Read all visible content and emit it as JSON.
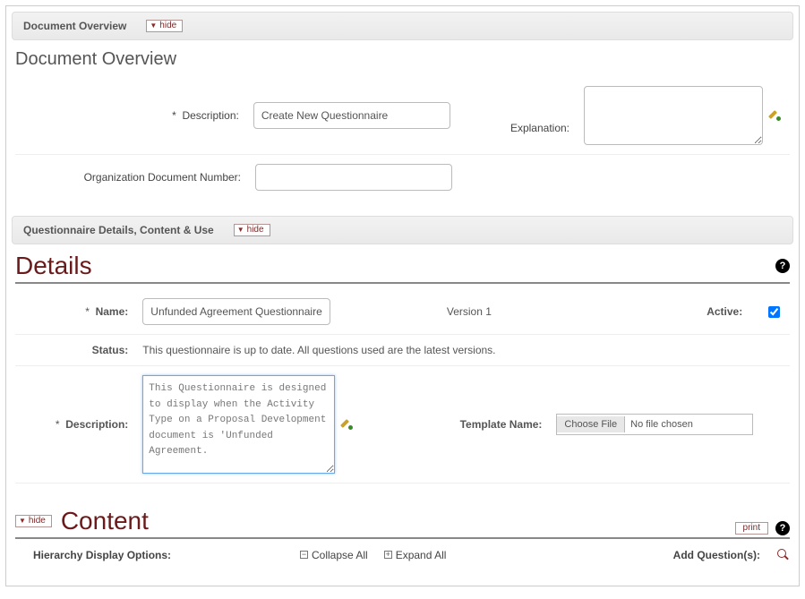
{
  "buttons": {
    "hide": "hide",
    "print": "print",
    "choose_file": "Choose File"
  },
  "overview_panel": {
    "header": "Document Overview",
    "title": "Document Overview",
    "description_label": "Description:",
    "description_value": "Create New Questionnaire",
    "odn_label": "Organization Document Number:",
    "odn_value": "",
    "explanation_label": "Explanation:",
    "explanation_value": ""
  },
  "qdcu_panel": {
    "header": "Questionnaire Details, Content & Use"
  },
  "details": {
    "title": "Details",
    "name_label": "Name:",
    "name_value": "Unfunded Agreement Questionnaire",
    "version_text": "Version 1",
    "active_label": "Active:",
    "active_checked": true,
    "status_label": "Status:",
    "status_value": "This questionnaire is up to date. All questions used are the latest versions.",
    "description_label": "Description:",
    "description_value": "This Questionnaire is designed to display when the Activity Type on a Proposal Development document is 'Unfunded Agreement.",
    "template_label": "Template Name:",
    "file_status": "No file chosen"
  },
  "content": {
    "title": "Content",
    "hier_label": "Hierarchy Display Options:",
    "collapse": "Collapse All",
    "expand": "Expand All",
    "add_q": "Add Question(s):"
  }
}
